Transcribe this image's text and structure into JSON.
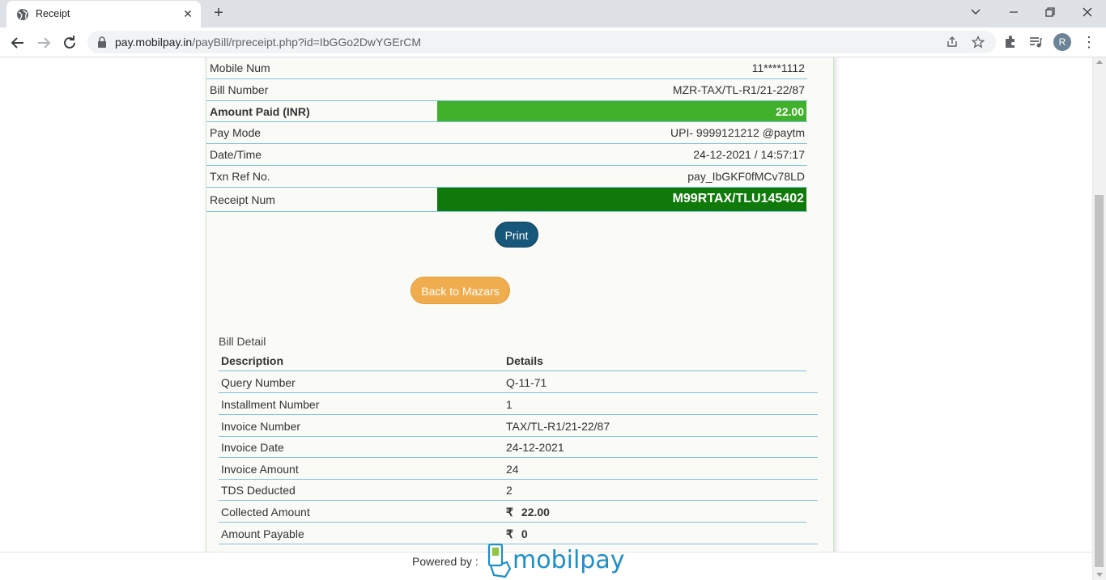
{
  "browser": {
    "tab_title": "Receipt",
    "url_host": "pay.mobilpay.in",
    "url_path": "/payBill/rpreceipt.php?id=IbGGo2DwYGErCM",
    "avatar_letter": "R"
  },
  "receipt": {
    "rows": [
      {
        "label": "Mobile Num",
        "value": "11****1112"
      },
      {
        "label": "Bill Number",
        "value": "MZR-TAX/TL-R1/21-22/87"
      },
      {
        "label": "Amount Paid (INR)",
        "value": "22.00"
      },
      {
        "label": "Pay Mode",
        "value": "UPI- 9999121212 @paytm"
      },
      {
        "label": "Date/Time",
        "value": "24-12-2021 / 14:57:17"
      },
      {
        "label": "Txn Ref No.",
        "value": "pay_IbGKF0fMCv78LD"
      },
      {
        "label": "Receipt Num",
        "value": "M99RTAX/TLU145402"
      }
    ],
    "colors": {
      "amount_fill": "#41b02a",
      "receipt_fill": "#0f7a0a"
    }
  },
  "actions": {
    "print_label": "Print",
    "back_label": "Back to Mazars"
  },
  "bill_detail": {
    "title": "Bill Detail",
    "headers": [
      "Description",
      "Details"
    ],
    "rows": [
      {
        "desc": "Query Number",
        "detail": "Q-11-71"
      },
      {
        "desc": "Installment Number",
        "detail": "1"
      },
      {
        "desc": "Invoice Number",
        "detail": "TAX/TL-R1/21-22/87"
      },
      {
        "desc": "Invoice Date",
        "detail": "24-12-2021"
      },
      {
        "desc": "Invoice Amount",
        "detail": "24"
      },
      {
        "desc": "TDS Deducted",
        "detail": "2"
      },
      {
        "desc": "Collected Amount",
        "detail": "22.00",
        "currency": "₹"
      },
      {
        "desc": "Amount Payable",
        "detail": "0",
        "currency": "₹"
      }
    ]
  },
  "footer": {
    "powered_by": "Powered by :",
    "brand": "mobilpay"
  }
}
